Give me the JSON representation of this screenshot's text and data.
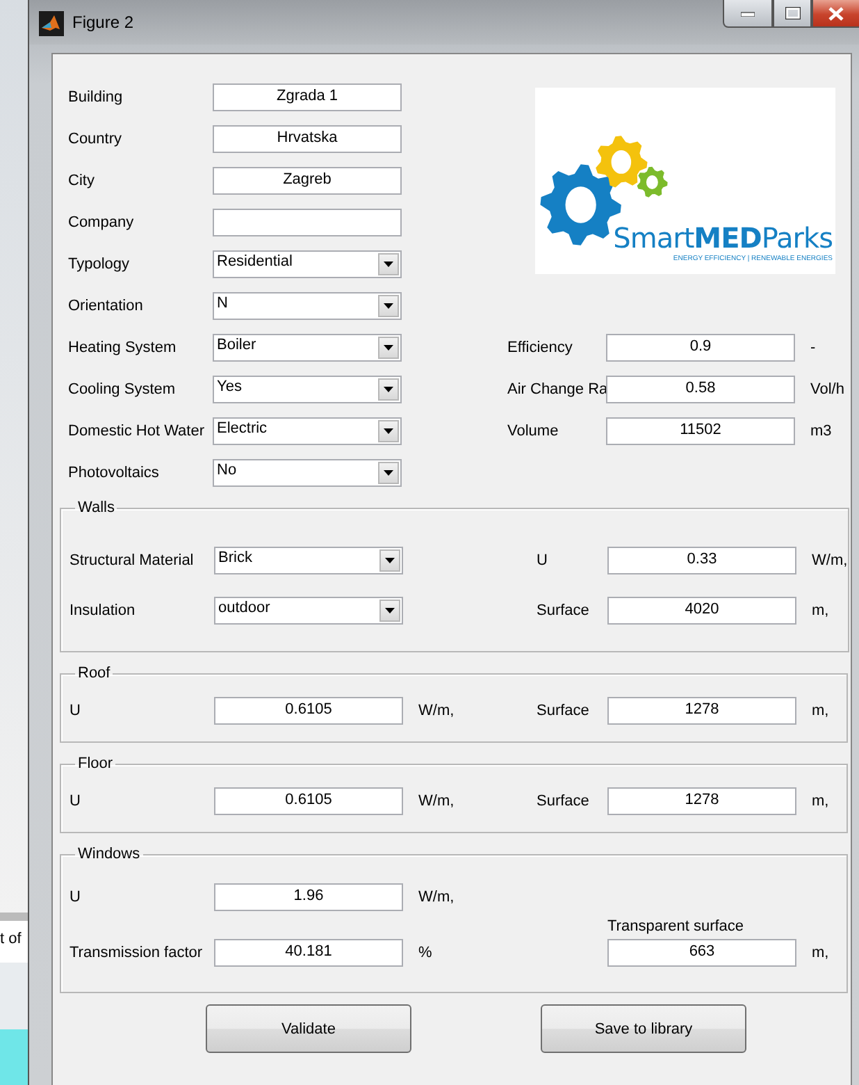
{
  "background": {
    "text": "t of"
  },
  "window": {
    "title": "Figure 2"
  },
  "general": [
    {
      "kind": "text",
      "label": "Building",
      "value": "Zgrada 1"
    },
    {
      "kind": "text",
      "label": "Country",
      "value": "Hrvatska"
    },
    {
      "kind": "text",
      "label": "City",
      "value": "Zagreb"
    },
    {
      "kind": "text",
      "label": "Company"
    },
    {
      "kind": "dropdown",
      "label": "Typology",
      "value": "Residential"
    },
    {
      "kind": "dropdown",
      "label": "Orientation",
      "value": "N"
    },
    {
      "kind": "dropdown",
      "label": "Heating System",
      "value": "Boiler"
    },
    {
      "kind": "dropdown",
      "label": "Cooling System",
      "value": "Yes"
    },
    {
      "kind": "dropdown",
      "label": "Domestic Hot Water",
      "value": "Electric"
    },
    {
      "kind": "dropdown",
      "label": "Photovoltaics",
      "value": "No"
    }
  ],
  "logo": {
    "name": "Smart**MED**Parks",
    "tagline": "ENERGY EFFICIENCY | RENEWABLE ENERGIES"
  },
  "system": [
    {
      "kind": "text",
      "label": "Efficiency",
      "value": "0.9",
      "unit": "-"
    },
    {
      "kind": "text",
      "label": "Air Change Ra",
      "value": "0.58",
      "unit": "Vol/h"
    },
    {
      "kind": "text",
      "label": "Volume",
      "value": "11502",
      "unit": "m3"
    }
  ],
  "sections": [
    {
      "title": "Walls",
      "rows": [
        {
          "left": {
            "kind": "dropdown",
            "label": "Structural Material",
            "value": "Brick"
          },
          "right": {
            "kind": "text",
            "label": "U",
            "value": "0.33",
            "unit": "W/m,"
          }
        },
        {
          "left": {
            "kind": "dropdown",
            "label": "Insulation",
            "value": "outdoor"
          },
          "right": {
            "kind": "text",
            "label": "Surface",
            "value": "4020",
            "unit": "m,"
          }
        }
      ]
    },
    {
      "title": "Roof",
      "rows": [
        {
          "left": {
            "kind": "text",
            "label": "U",
            "value": "0.6105",
            "unit": "W/m,"
          },
          "right": {
            "kind": "text",
            "label": "Surface",
            "value": "1278",
            "unit": "m,"
          }
        }
      ]
    },
    {
      "title": "Floor",
      "rows": [
        {
          "left": {
            "kind": "text",
            "label": "U",
            "value": "0.6105",
            "unit": "W/m,"
          },
          "right": {
            "kind": "text",
            "label": "Surface",
            "value": "1278",
            "unit": "m,"
          }
        }
      ]
    },
    {
      "title": "Windows",
      "rows": [
        {
          "left": {
            "kind": "text",
            "label": "U",
            "value": "1.96",
            "unit": "W/m,"
          }
        },
        {
          "left": {
            "kind": "text",
            "label": "Transmission factor",
            "value": "40.181",
            "unit": "%"
          },
          "right": {
            "kind": "stacked",
            "label": "Transparent surface",
            "value": "663",
            "unit": "m,"
          }
        }
      ]
    }
  ],
  "buttons": [
    "Validate",
    "Save to library"
  ]
}
